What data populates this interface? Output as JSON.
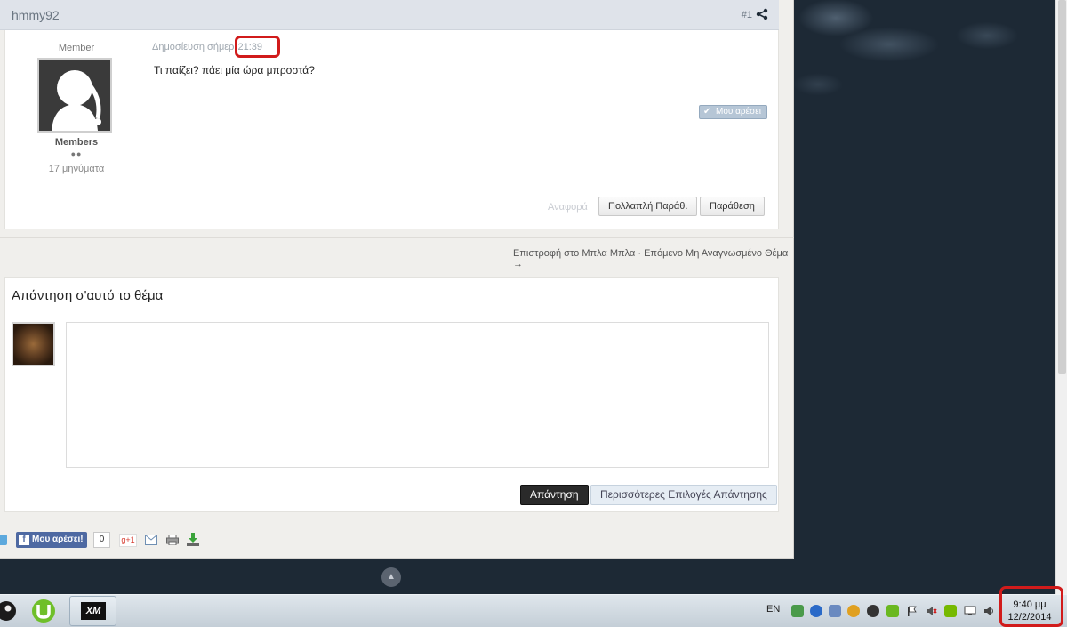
{
  "post": {
    "author": "hmmy92",
    "number": "#1",
    "member_title": "Member",
    "group": "Members",
    "rank_dots": "●●",
    "post_count": "17 μηνύματα",
    "posted_label": "Δημοσίευση σήμερ",
    "time": "21:39",
    "text": "Τι παίζει? πάει μία ώρα μπροστά?",
    "like_label": "Μου αρέσει",
    "report_label": "Αναφορά",
    "multiquote_label": "Πολλαπλή Παράθ.",
    "quote_label": "Παράθεση"
  },
  "thread_nav": {
    "back": "Επιστροφή στο Μπλα Μπλα",
    "separator": "·",
    "next": "Επόμενο Μη Αναγνωσμένο Θέμα →"
  },
  "reply": {
    "title": "Απάντηση σ'αυτό το θέμα",
    "submit_label": "Απάντηση",
    "more_label": "Περισσότερες Επιλογές Απάντησης"
  },
  "share": {
    "fb_like": "Μου αρέσει!",
    "fb_count": "0",
    "gplus": "g+1"
  },
  "scroll_top_icon": "▲",
  "taskbar": {
    "language": "EN",
    "clock_time": "9:40 μμ",
    "clock_date": "12/2/2014",
    "xm_label": "XM"
  },
  "colors": {
    "highlight": "#d11b1b",
    "reply_button": "#2a2a2a",
    "like_button": "#b6c6d6"
  }
}
